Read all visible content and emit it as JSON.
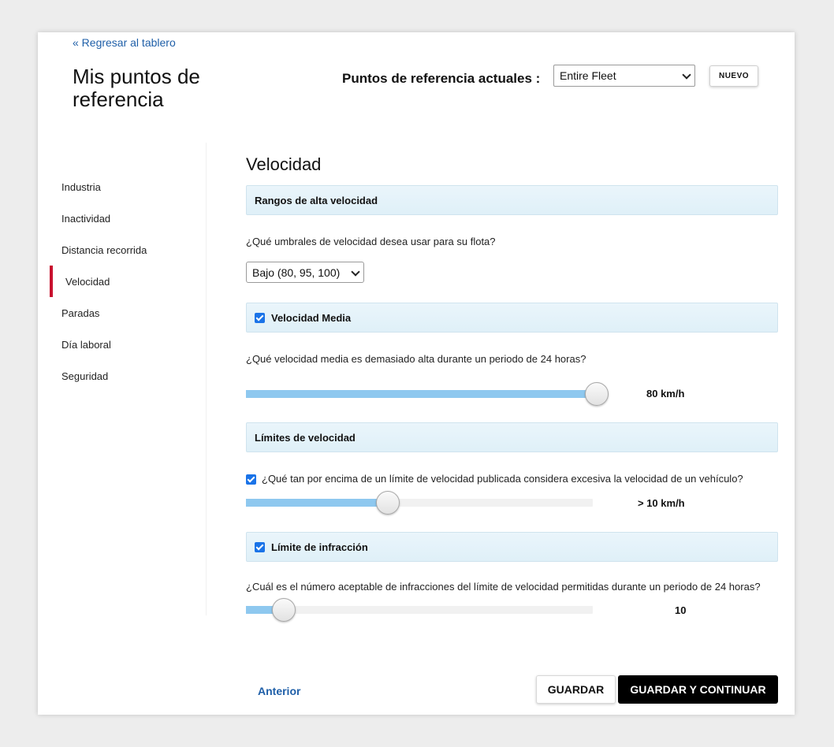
{
  "header": {
    "back_link": "« Regresar al tablero",
    "title": "Mis puntos de referencia",
    "ref_label": "Puntos de referencia actuales :",
    "fleet_selected": "Entire Fleet",
    "new_button": "NUEVO"
  },
  "sidebar": {
    "items": [
      {
        "label": "Industria"
      },
      {
        "label": "Inactividad"
      },
      {
        "label": "Distancia recorrida"
      },
      {
        "label": "Velocidad",
        "active": true
      },
      {
        "label": "Paradas"
      },
      {
        "label": "Día laboral"
      },
      {
        "label": "Seguridad"
      }
    ],
    "active_color": "#c8102e"
  },
  "main": {
    "section_title": "Velocidad",
    "high_speed": {
      "panel_label": "Rangos de alta velocidad",
      "question": "¿Qué umbrales de velocidad desea usar para su flota?",
      "selected_threshold": "Bajo (80, 95, 100)"
    },
    "average_speed": {
      "panel_label": "Velocidad Media",
      "checked": true,
      "question": "¿Qué velocidad media es demasiado alta durante un periodo de 24 horas?",
      "value_label": "80 km/h",
      "slider_fraction": 1.0
    },
    "speed_limits": {
      "panel_label": "Límites de velocidad",
      "checked": true,
      "question": "¿Qué tan por encima de un límite de velocidad publicada considera excesiva la velocidad de un vehículo?",
      "value_label": "> 10 km/h",
      "slider_fraction": 0.41
    },
    "infraction_limit": {
      "panel_label": "Límite de infracción",
      "checked": true,
      "question": "¿Cuál es el número aceptable de infracciones del límite de velocidad permitidas durante un periodo de 24 horas?",
      "value_label": "10",
      "slider_fraction": 0.11
    }
  },
  "footer": {
    "previous": "Anterior",
    "save": "GUARDAR",
    "save_continue": "GUARDAR Y CONTINUAR"
  },
  "colors": {
    "accent": "#1a73e8",
    "slider_fill": "#8ec8ef",
    "link": "#1f5fa8",
    "panel_bg": "#e4f2f9"
  }
}
